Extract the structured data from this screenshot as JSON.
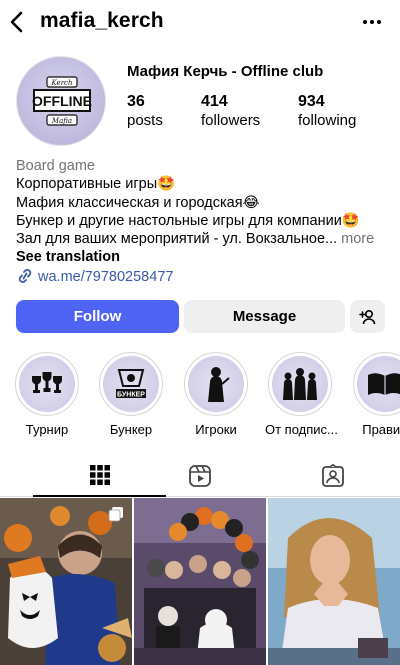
{
  "header": {
    "username": "mafia_kerch"
  },
  "profile": {
    "display_name": "Мафия Керчь - Offline club",
    "avatar_logo_text": "OFFLINE",
    "avatar_logo_top": "Kerch",
    "avatar_logo_bottom": "Mafia",
    "stats": [
      {
        "value": "36",
        "label": "posts"
      },
      {
        "value": "414",
        "label": "followers"
      },
      {
        "value": "934",
        "label": "following"
      }
    ]
  },
  "bio": {
    "category": "Board game",
    "lines": [
      "Корпоративные игры🤩",
      "Мафия классическая и городская😂",
      "Бункер и другие настольные игры для компании🤩",
      "Зал для ваших мероприятий - ул. Вокзальное..."
    ],
    "more": "more",
    "see_translation": "See translation",
    "link": "wa.me/79780258477"
  },
  "actions": {
    "follow": "Follow",
    "message": "Message"
  },
  "highlights": [
    {
      "label": "Турнир",
      "icon": "trophies-icon"
    },
    {
      "label": "Бункер",
      "icon": "bunker-logo-icon"
    },
    {
      "label": "Игроки",
      "icon": "player-icon"
    },
    {
      "label": "От подпис...",
      "icon": "people-group-icon"
    },
    {
      "label": "Правил",
      "icon": "book-icon"
    }
  ],
  "highlight_logo_text": "БУНКЕР",
  "tabs": [
    "posts-grid-icon",
    "reels-icon",
    "tagged-icon"
  ],
  "colors": {
    "follow_button": "#4f63f5",
    "link": "#3b5aa8",
    "secondary_text": "#737373",
    "button_gray": "#efefef"
  }
}
